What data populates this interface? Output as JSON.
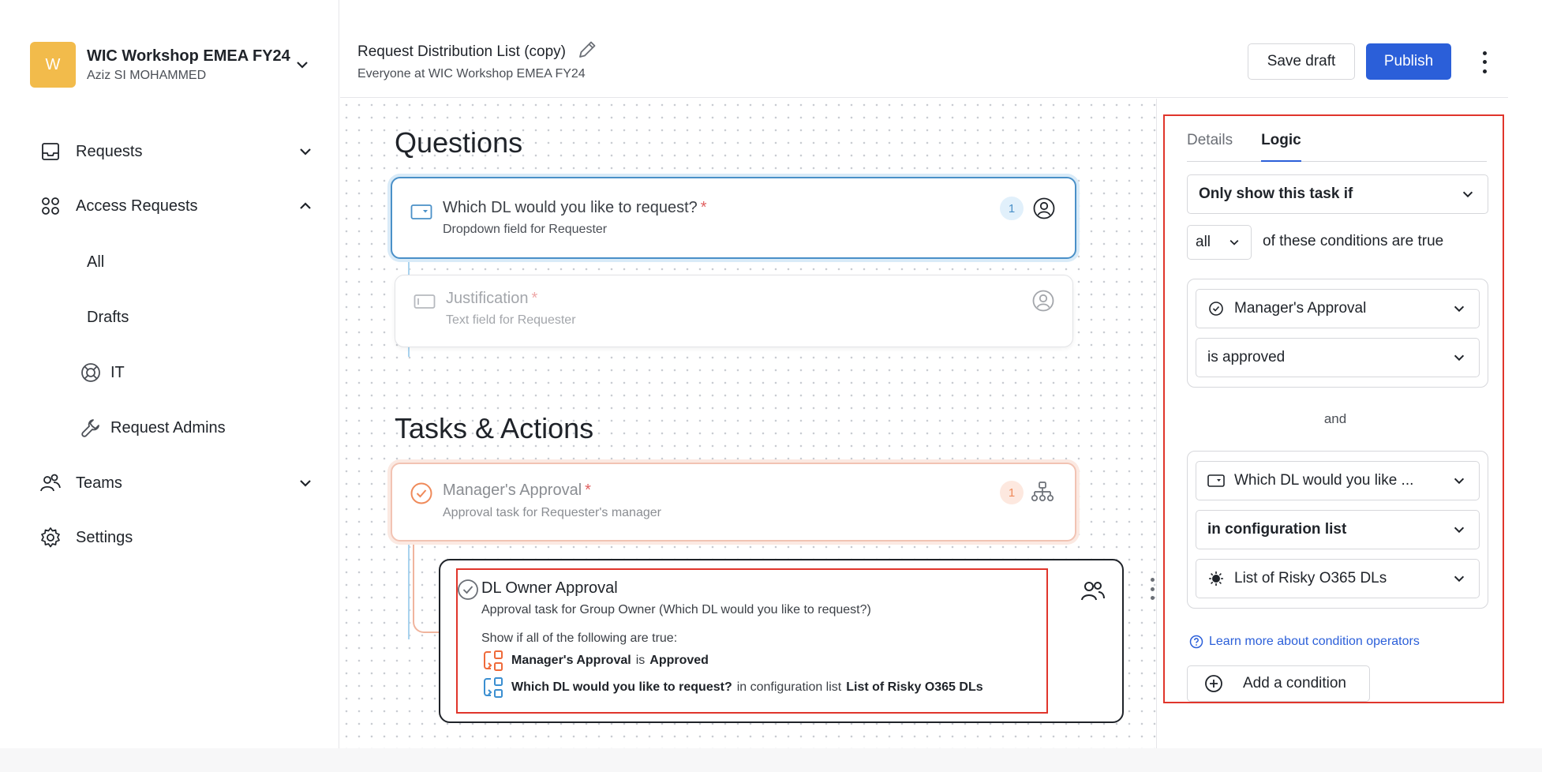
{
  "workspace": {
    "initial": "W",
    "name": "WIC Workshop EMEA FY24",
    "user": "Aziz SI MOHAMMED"
  },
  "nav": {
    "requests": "Requests",
    "access_requests": "Access Requests",
    "all": "All",
    "drafts": "Drafts",
    "it": "IT",
    "request_admins": "Request Admins",
    "teams": "Teams",
    "settings": "Settings"
  },
  "header": {
    "title": "Request Distribution List (copy)",
    "subtitle": "Everyone at WIC Workshop EMEA FY24",
    "save_draft": "Save draft",
    "publish": "Publish"
  },
  "canvas": {
    "questions_title": "Questions",
    "tasks_title": "Tasks & Actions",
    "q1": {
      "title": "Which DL would you like to request?",
      "required": "*",
      "subtitle": "Dropdown field for Requester",
      "count": "1"
    },
    "q2": {
      "title": "Justification",
      "required": "*",
      "subtitle": "Text field for Requester"
    },
    "t1": {
      "title": "Manager's Approval",
      "required": "*",
      "subtitle": "Approval task for Requester's manager",
      "count": "1"
    },
    "t2": {
      "title": "DL Owner Approval",
      "subtitle": "Approval task for Group Owner (Which DL would you like to request?)",
      "show_if": "Show if all of the following are true:",
      "cond1_subject": "Manager's Approval",
      "cond1_op": "is",
      "cond1_value": "Approved",
      "cond2_subject": "Which DL would you like to request?",
      "cond2_op": "in configuration list",
      "cond2_value": "List of Risky O365 DLs"
    }
  },
  "panel": {
    "tab_details": "Details",
    "tab_logic": "Logic",
    "visibility": "Only show this task if",
    "match_mode": "all",
    "match_text": "of these conditions are true",
    "group1": {
      "subject": "Manager's Approval",
      "operator": "is approved"
    },
    "and_label": "and",
    "group2": {
      "subject": "Which DL would you like ...",
      "operator": "in configuration list",
      "value": "List of Risky O365 DLs"
    },
    "learn_more": "Learn more about condition operators",
    "add_condition": "Add a condition"
  },
  "colors": {
    "accent": "#2b5fd9",
    "highlight": "#e0352b",
    "question_border": "#4a90c8",
    "task_border": "#f2c3b3",
    "task_accent": "#ef8a5a",
    "workspace_avatar": "#f2bb4b"
  }
}
